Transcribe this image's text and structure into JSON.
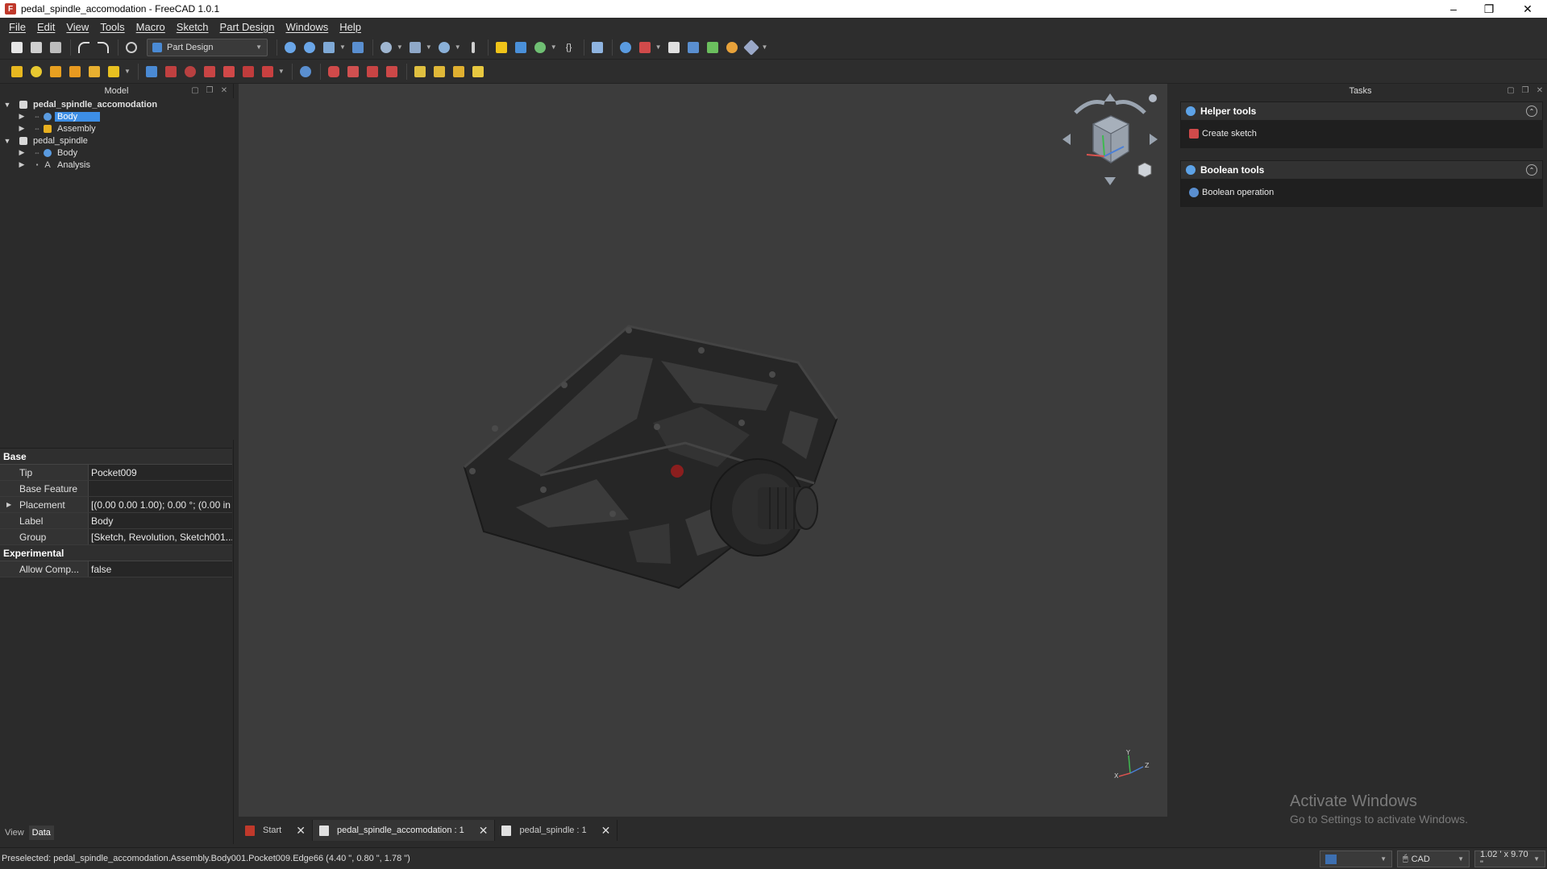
{
  "window": {
    "title": "pedal_spindle_accomodation - FreeCAD 1.0.1",
    "controls": {
      "minimize": "–",
      "maximize": "❐",
      "close": "✕"
    }
  },
  "menu": [
    "File",
    "Edit",
    "View",
    "Tools",
    "Macro",
    "Sketch",
    "Part Design",
    "Windows",
    "Help"
  ],
  "toolbar": {
    "workbench": "Part Design"
  },
  "model_panel": {
    "header": "Model",
    "tree": [
      {
        "label": "pedal_spindle_accomodation",
        "level": 0,
        "expanded": true
      },
      {
        "label": "Body",
        "level": 1,
        "selected": true
      },
      {
        "label": "Assembly",
        "level": 1
      },
      {
        "label": "pedal_spindle",
        "level": 0,
        "expanded": true
      },
      {
        "label": "Body",
        "level": 1
      },
      {
        "label": "Analysis",
        "level": 1
      }
    ]
  },
  "properties": {
    "group_base": "Base",
    "rows_base": [
      {
        "name": "Tip",
        "value": "Pocket009"
      },
      {
        "name": "Base Feature",
        "value": ""
      },
      {
        "name": "Placement",
        "value": "[(0.00 0.00 1.00); 0.00 °; (0.00 in ..."
      },
      {
        "name": "Label",
        "value": "Body"
      },
      {
        "name": "Group",
        "value": "[Sketch, Revolution, Sketch001..."
      }
    ],
    "group_experimental": "Experimental",
    "rows_experimental": [
      {
        "name": "Allow Comp...",
        "value": "false"
      }
    ]
  },
  "left_tabs": {
    "view": "View",
    "data": "Data"
  },
  "doc_tabs": [
    {
      "label": "Start"
    },
    {
      "label": "pedal_spindle_accomodation : 1"
    },
    {
      "label": "pedal_spindle : 1"
    }
  ],
  "axis_labels": {
    "x": "X",
    "y": "Y",
    "z": "Z"
  },
  "tasks": {
    "header": "Tasks",
    "helper_tools": {
      "title": "Helper tools",
      "item": "Create sketch"
    },
    "boolean_tools": {
      "title": "Boolean tools",
      "item": "Boolean operation"
    }
  },
  "watermark": {
    "line1": "Activate Windows",
    "line2": "Go to Settings to activate Windows."
  },
  "statusbar": {
    "text": "Preselected: pedal_spindle_accomodation.Assembly.Body001.Pocket009.Edge66 (4.40 \", 0.80 \", 1.78 \")",
    "nav_style": "CAD",
    "dimensions": "1.02 ' x 9.70 \""
  },
  "colors": {
    "selection": "#3d8ee6",
    "background": "#2b2b2b",
    "viewport": "#3c3c3c"
  }
}
